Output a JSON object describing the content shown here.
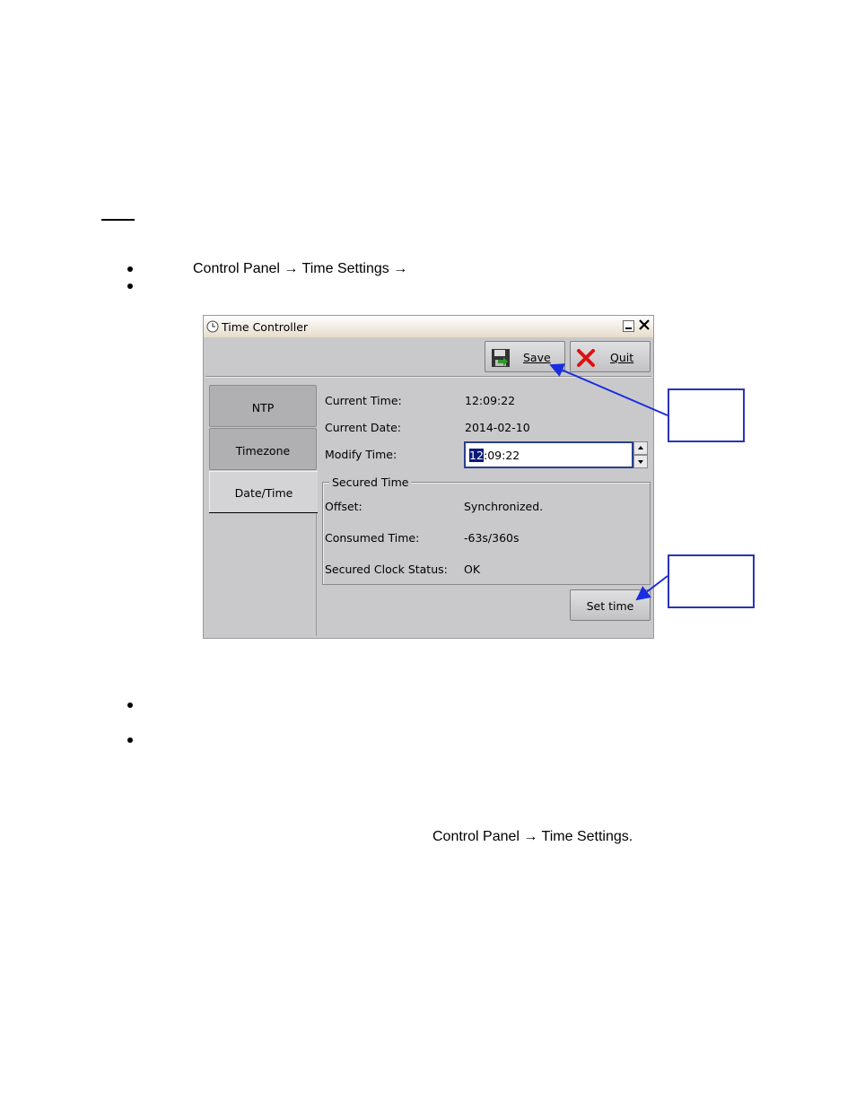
{
  "doc": {
    "bullet1_text": "Control Panel → Time Settings →",
    "bottom_text": "Control Panel → Time Settings."
  },
  "window": {
    "title": "Time Controller",
    "toolbar": {
      "save_label": "Save",
      "quit_label": "Quit"
    },
    "tabs": [
      {
        "label": "NTP"
      },
      {
        "label": "Timezone"
      },
      {
        "label": "Date/Time"
      }
    ],
    "fields": {
      "current_time_label": "Current Time:",
      "current_time_value": "12:09:22",
      "current_date_label": "Current Date:",
      "current_date_value": "2014-02-10",
      "modify_time_label": "Modify Time:",
      "modify_time_selected": "12",
      "modify_time_rest": ":09:22"
    },
    "secured_time": {
      "legend": "Secured Time",
      "offset_label": "Offset:",
      "offset_value": "Synchronized.",
      "consumed_label": "Consumed Time:",
      "consumed_value": "-63s/360s",
      "status_label": "Secured Clock Status:",
      "status_value": "OK"
    },
    "set_time_label": "Set time"
  },
  "colors": {
    "window_bg": "#c9c9cb",
    "callout_border": "#2a33b8",
    "selection": "#0b1a78"
  }
}
